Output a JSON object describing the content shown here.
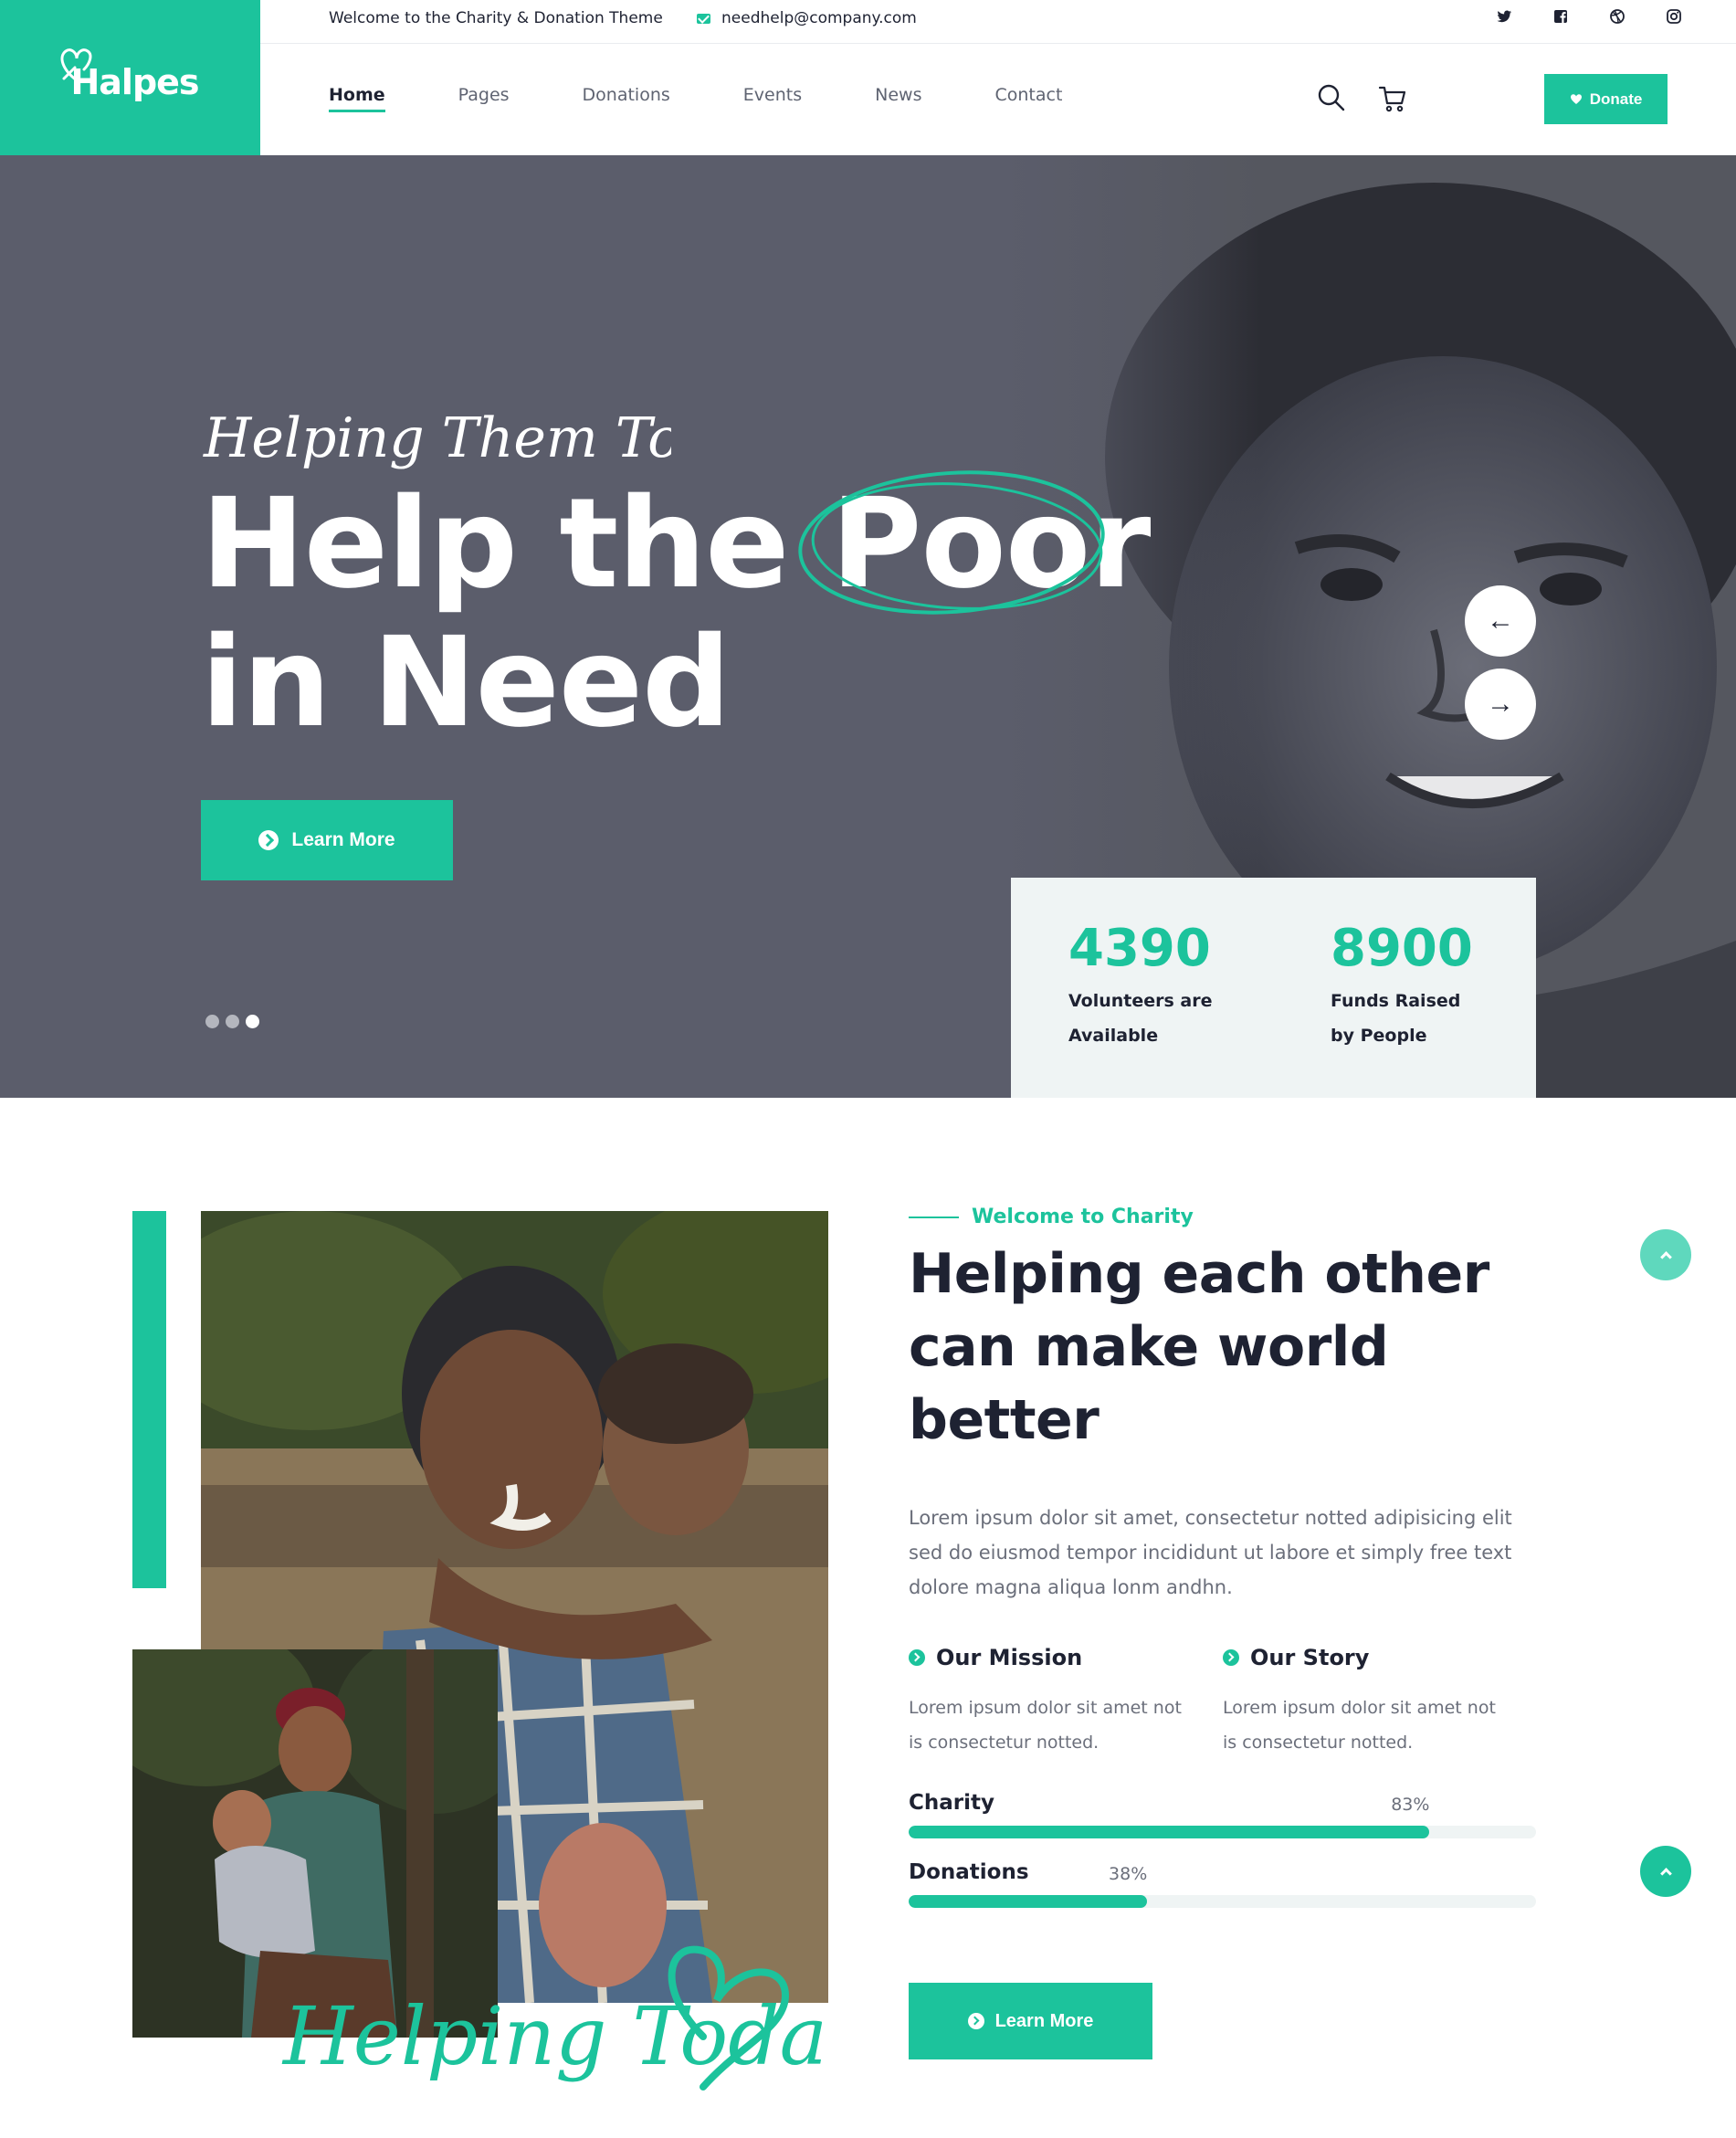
{
  "brand": {
    "name": "Halpes",
    "accent": "#1cc39c",
    "dark": "#1e2232",
    "muted": "#6b6f7b"
  },
  "topbar": {
    "welcome": "Welcome to the Charity & Donation Theme",
    "email": "needhelp@company.com",
    "socials": [
      "twitter-icon",
      "facebook-icon",
      "dribbble-icon",
      "instagram-icon"
    ]
  },
  "nav": {
    "items": [
      {
        "label": "Home",
        "active": true
      },
      {
        "label": "Pages"
      },
      {
        "label": "Donations"
      },
      {
        "label": "Events"
      },
      {
        "label": "News"
      },
      {
        "label": "Contact"
      }
    ],
    "donate_label": "Donate"
  },
  "hero": {
    "script": "Helping Them Today",
    "title_line1_a": "Help the ",
    "title_line1_b": "Poor",
    "title_line2": "in Need",
    "learn_more": "Learn More",
    "prev_arrow": "←",
    "next_arrow": "→",
    "slides": 3,
    "active_slide": 3,
    "stats": [
      {
        "value": "4390",
        "label": "Volunteers are Available"
      },
      {
        "value": "8900",
        "label": "Funds Raised by People"
      }
    ]
  },
  "about": {
    "eyebrow": "Welcome to Charity",
    "title_line1": "Helping each other",
    "title_line2": "can make world better",
    "text": "Lorem ipsum dolor sit amet, consectetur notted adipisicing elit sed do eiusmod tempor incididunt ut labore et simply free text dolore magna aliqua lonm andhn.",
    "features": [
      {
        "title": "Our Mission",
        "text": "Lorem ipsum dolor sit amet not is consectetur notted."
      },
      {
        "title": "Our Story",
        "text": "Lorem ipsum dolor sit amet not is consectetur notted."
      }
    ],
    "progress": [
      {
        "label": "Charity",
        "percent_text": "83%",
        "value": 0.83
      },
      {
        "label": "Donations",
        "percent_text": "38%",
        "value": 0.38
      }
    ],
    "learn_more": "Learn More",
    "script": "Helping Today"
  }
}
